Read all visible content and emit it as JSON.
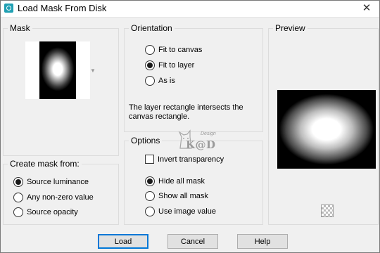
{
  "window": {
    "title": "Load Mask From Disk",
    "close_glyph": "✕"
  },
  "mask": {
    "label": "Mask"
  },
  "orientation": {
    "label": "Orientation",
    "options": [
      {
        "label": "Fit to canvas",
        "checked": false
      },
      {
        "label": "Fit to layer",
        "checked": true
      },
      {
        "label": "As is",
        "checked": false
      }
    ],
    "note": "The layer rectangle intersects the canvas rectangle."
  },
  "create_mask": {
    "label": "Create mask from:",
    "options": [
      {
        "label": "Source luminance",
        "checked": true
      },
      {
        "label": "Any non-zero value",
        "checked": false
      },
      {
        "label": "Source opacity",
        "checked": false
      }
    ]
  },
  "options": {
    "label": "Options",
    "invert_label": "Invert transparency",
    "invert_checked": false,
    "mask_options": [
      {
        "label": "Hide all mask",
        "checked": true
      },
      {
        "label": "Show all mask",
        "checked": false
      },
      {
        "label": "Use image value",
        "checked": false
      }
    ]
  },
  "preview": {
    "label": "Preview"
  },
  "watermark": {
    "small": "Design",
    "text": "K@D"
  },
  "buttons": {
    "load": "Load",
    "cancel": "Cancel",
    "help": "Help"
  }
}
